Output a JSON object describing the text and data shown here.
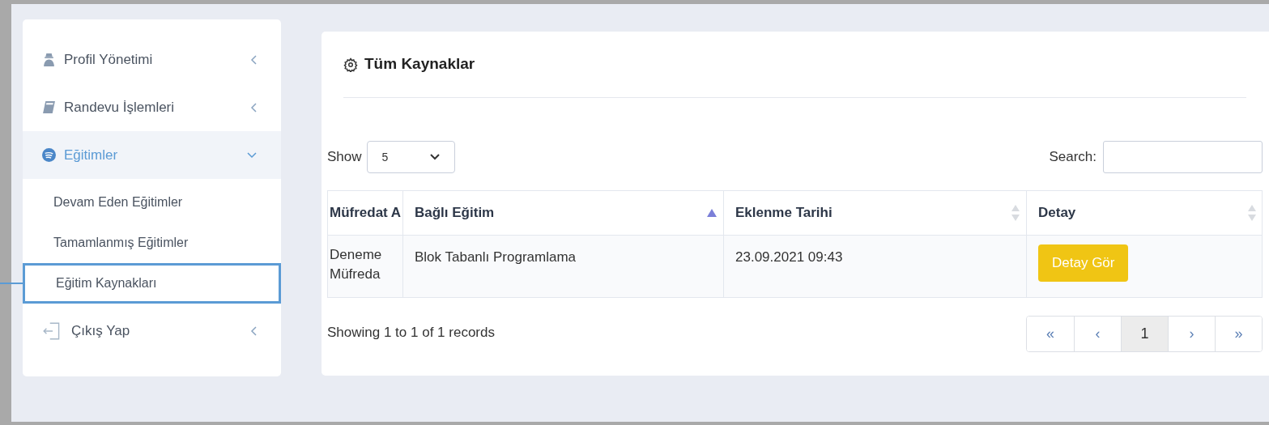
{
  "sidebar": {
    "items": [
      {
        "label": "Profil Yönetimi",
        "expanded": false
      },
      {
        "label": "Randevu İşlemleri",
        "expanded": false
      },
      {
        "label": "Eğitimler",
        "expanded": true,
        "children": [
          {
            "label": "Devam Eden Eğitimler",
            "highlighted": false
          },
          {
            "label": "Tamamlanmış Eğitimler",
            "highlighted": false
          },
          {
            "label": "Eğitim Kaynakları",
            "highlighted": true
          }
        ]
      },
      {
        "label": "Çıkış Yap",
        "expanded": false
      }
    ]
  },
  "panel": {
    "title": "Tüm Kaynaklar",
    "show_label": "Show",
    "page_size": "5",
    "search_label": "Search:",
    "table": {
      "columns": [
        {
          "label": "Müfredat A",
          "sortable": false,
          "selected": false
        },
        {
          "label": "Bağlı Eğitim",
          "sortable": true,
          "selected": true
        },
        {
          "label": "Eklenme Tarihi",
          "sortable": true,
          "selected": false
        },
        {
          "label": "Detay",
          "sortable": true,
          "selected": false
        }
      ],
      "rows": [
        {
          "cells": [
            "Deneme Müfreda",
            "Blok Tabanlı Programlama",
            "23.09.2021 09:43"
          ],
          "action": "Detay Gör"
        }
      ]
    },
    "info": "Showing 1 to 1 of 1 records",
    "pagination": [
      {
        "label": "«",
        "selected": false
      },
      {
        "label": "‹",
        "selected": false
      },
      {
        "label": "1",
        "selected": true
      },
      {
        "label": "›",
        "selected": false
      },
      {
        "label": "»",
        "selected": false
      }
    ]
  }
}
